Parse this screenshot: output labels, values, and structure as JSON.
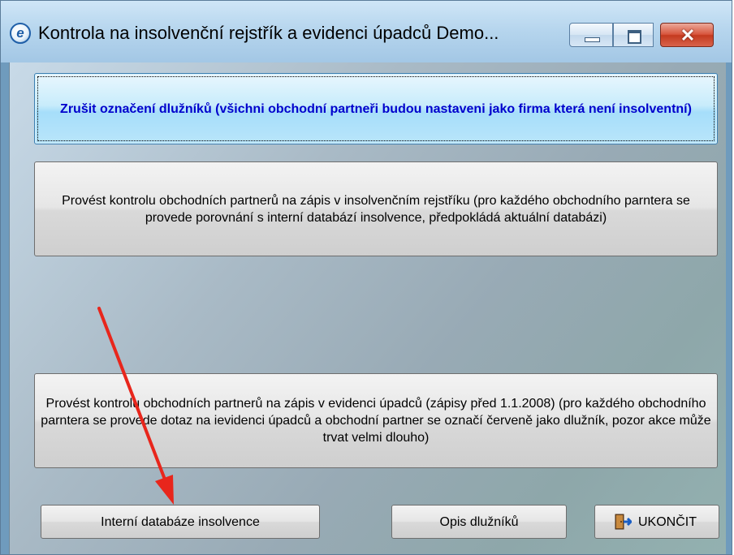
{
  "window": {
    "title": "Kontrola na insolvenční rejstřík a evidenci úpadců  Demo...",
    "app_icon_glyph": "e",
    "close_glyph": "✕"
  },
  "buttons": {
    "unmark_debtors": "Zrušit označení dlužníků  (všichni obchodní partneři budou nastaveni jako firma která není insolventní)",
    "check_insolvency_register": "Provést kontrolu obchodních partnerů na zápis v insolvenčním rejstříku (pro každého obchodního parntera se provede porovnání s interní databází insolvence, předpokládá aktuální databázi)",
    "check_bankruptcy_records": "Provést kontrolu obchodních partnerů na zápis v evidenci úpadců (zápisy před 1.1.2008) (pro každého obchodního parntera se provede dotaz na ievidenci úpadců a obchodní partner se označí červeně jako dlužník, pozor akce může trvat velmi dlouho)",
    "internal_database": "Interní databáze insolvence",
    "debtors_list": "Opis dlužníků",
    "exit": "UKONČIT"
  },
  "icons": {
    "app": "app-e-icon",
    "minimize": "minimize-icon",
    "maximize": "maximize-icon",
    "close": "close-icon",
    "exit": "exit-door-icon"
  },
  "annotation": {
    "arrow_color": "#e8261c"
  }
}
